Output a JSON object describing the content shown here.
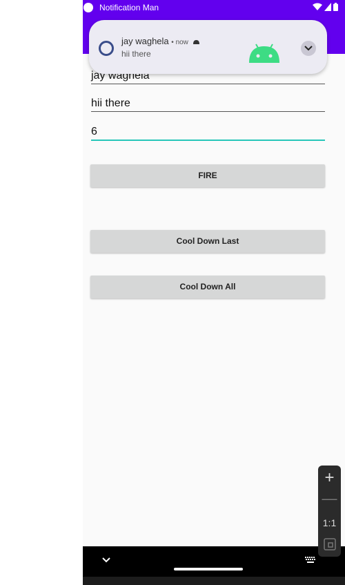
{
  "status_bar": {
    "app_title": "Notification Man"
  },
  "notification": {
    "sender": "jay waghela",
    "time": "now",
    "message": "hii there"
  },
  "form": {
    "field_title": "jay waghela",
    "field_message": "hii there",
    "field_count": "6"
  },
  "buttons": {
    "fire": "FIRE",
    "cool_down_last": "Cool Down Last",
    "cool_down_all": "Cool Down All"
  },
  "zoom_panel": {
    "ratio": "1:1"
  },
  "colors": {
    "primary": "#6200ee",
    "accent": "#26c6b9",
    "android_green": "#3ddc84"
  }
}
